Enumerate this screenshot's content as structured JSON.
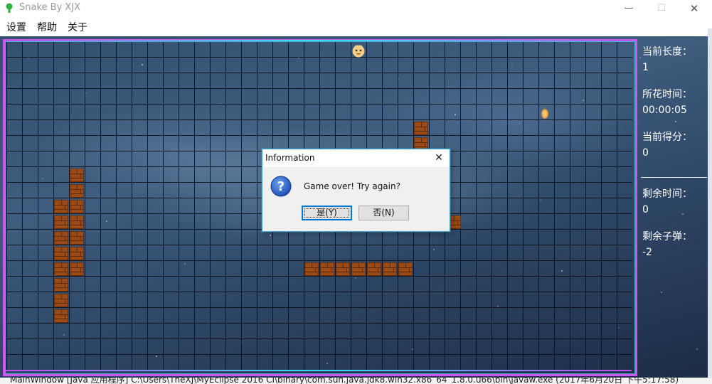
{
  "window": {
    "title": "Snake By XJX",
    "minimize_glyph": "—",
    "maximize_glyph": "☐",
    "close_glyph": "✕"
  },
  "menu": {
    "items": [
      {
        "label": "设置"
      },
      {
        "label": "帮助"
      },
      {
        "label": "关于"
      }
    ]
  },
  "side_panel": {
    "length_label": "当前长度：",
    "length_value": "1",
    "time_label": "所花时间：",
    "time_value": "00:00:05",
    "score_label": "当前得分：",
    "score_value": "0",
    "remaining_time_label": "剩余时间：",
    "remaining_time_value": "0",
    "remaining_bullets_label": "剩余子弹：",
    "remaining_bullets_value": "-2"
  },
  "dialog": {
    "title": "Information",
    "close_glyph": "✕",
    "message": "Game over! Try again?",
    "yes_label": "是(Y)",
    "no_label": "否(N)",
    "icon": "question-icon"
  },
  "status_line": {
    "text": "MainWindow [Java 应用程序] C:\\Users\\TheXJ\\MyEclipse 2016 CI\\binary\\com.sun.java.jdk8.win32.x86_64_1.8.0.u66\\bin\\javaw.exe (2017年6月20日 下午5:17:58)"
  },
  "colors": {
    "frame": "#cf55ee",
    "frame_glow": "#39d6f5",
    "brick": "#9a4a16",
    "dialog_accent": "#0078d7"
  }
}
